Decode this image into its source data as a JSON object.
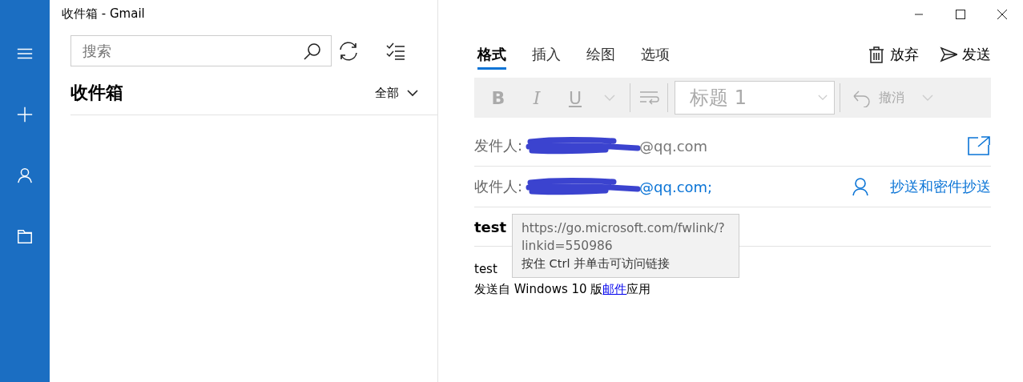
{
  "window": {
    "title": "收件箱 - Gmail"
  },
  "rail": {
    "items": [
      {
        "kind": "menu"
      },
      {
        "kind": "new"
      },
      {
        "kind": "account"
      },
      {
        "kind": "folder"
      }
    ]
  },
  "list_pane": {
    "search": {
      "placeholder": "搜索"
    },
    "folder_title": "收件箱",
    "filter": "全部"
  },
  "compose": {
    "tabs": [
      {
        "label": "格式",
        "selected": true
      },
      {
        "label": "插入",
        "selected": false
      },
      {
        "label": "绘图",
        "selected": false
      },
      {
        "label": "选项",
        "selected": false
      }
    ],
    "actions": [
      {
        "kind": "discard",
        "label": "放弃"
      },
      {
        "kind": "send",
        "label": "发送"
      }
    ],
    "toolbar": {
      "disabled": true,
      "bold": "B",
      "italic": "I",
      "underline": "U",
      "style": "标题 1",
      "undo": "撤消"
    },
    "from": {
      "label": "发件人:",
      "value": "@qq.com"
    },
    "to": {
      "label": "收件人:",
      "value": "@qq.com;",
      "cc_link": "抄送和密件抄送"
    },
    "subject": "test",
    "tooltip": {
      "url": "https://go.microsoft.com/fwlink/?linkid=550986",
      "hint": "按住 Ctrl 并单击可访问链接"
    },
    "body": {
      "line": "test",
      "signature": {
        "before": "发送自 Windows 10 版",
        "link": "邮件",
        "after": "应用"
      }
    }
  }
}
